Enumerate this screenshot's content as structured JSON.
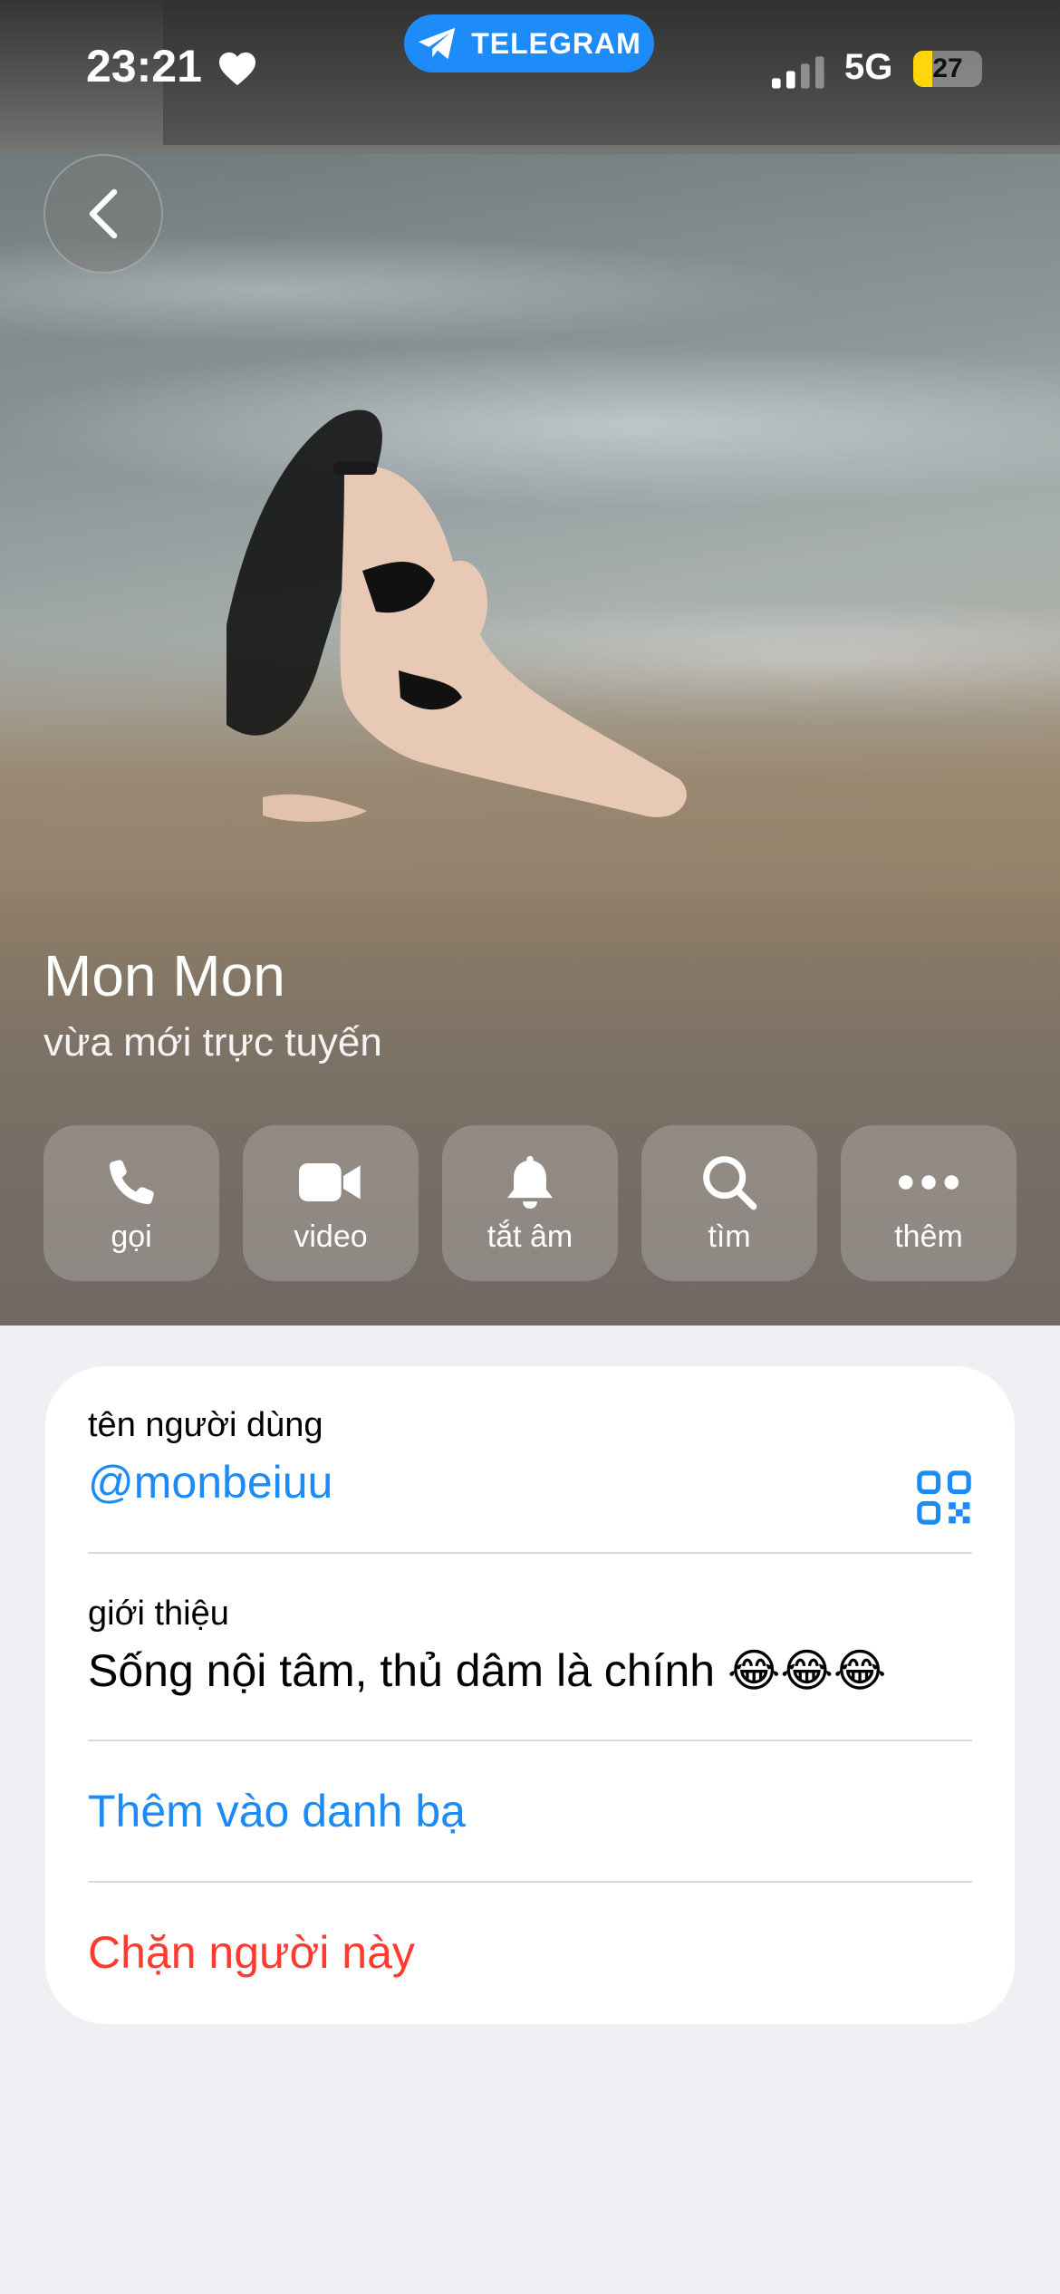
{
  "status_bar": {
    "time": "23:21",
    "app_pill": "TELEGRAM",
    "network": "5G",
    "battery_level": "27",
    "battery_fraction": 0.27,
    "battery_color": "#ffd60a"
  },
  "profile": {
    "name": "Mon Mon",
    "status": "vừa mới trực tuyến"
  },
  "actions": [
    {
      "label": "gọi",
      "icon": "phone-icon"
    },
    {
      "label": "video",
      "icon": "video-camera-icon"
    },
    {
      "label": "tắt âm",
      "icon": "bell-icon"
    },
    {
      "label": "tìm",
      "icon": "search-icon"
    },
    {
      "label": "thêm",
      "icon": "more-icon"
    }
  ],
  "info": {
    "username_label": "tên người dùng",
    "username": "@monbeiuu",
    "bio_label": "giới thiệu",
    "bio": "Sống nội tâm, thủ dâm là chính 😂😂😂",
    "add_contact": "Thêm vào danh bạ",
    "block": "Chặn người này"
  },
  "colors": {
    "accent": "#1c8bf5",
    "danger": "#ff3b30",
    "telegram_blue": "#1d8cf8",
    "background": "#efeff4"
  }
}
